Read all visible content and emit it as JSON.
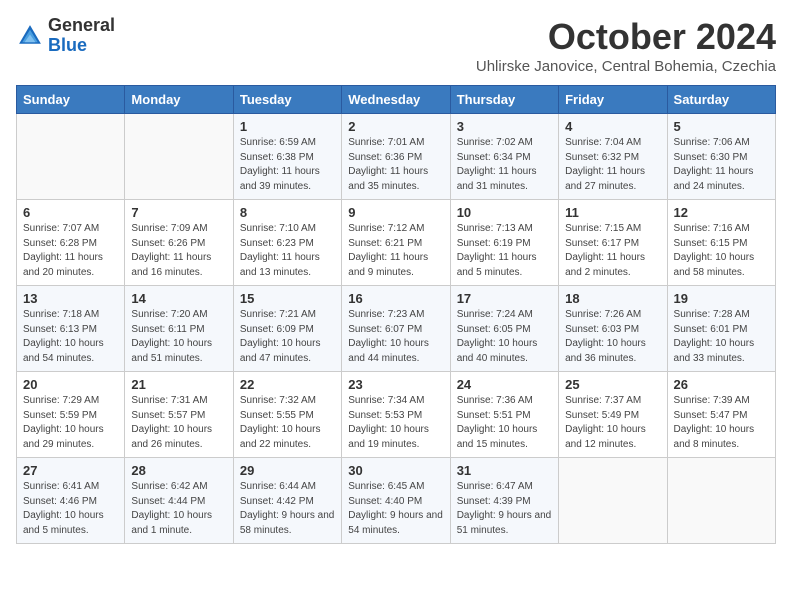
{
  "header": {
    "logo_general": "General",
    "logo_blue": "Blue",
    "month_title": "October 2024",
    "subtitle": "Uhlirske Janovice, Central Bohemia, Czechia"
  },
  "days_of_week": [
    "Sunday",
    "Monday",
    "Tuesday",
    "Wednesday",
    "Thursday",
    "Friday",
    "Saturday"
  ],
  "weeks": [
    [
      {
        "day": "",
        "info": ""
      },
      {
        "day": "",
        "info": ""
      },
      {
        "day": "1",
        "info": "Sunrise: 6:59 AM\nSunset: 6:38 PM\nDaylight: 11 hours and 39 minutes."
      },
      {
        "day": "2",
        "info": "Sunrise: 7:01 AM\nSunset: 6:36 PM\nDaylight: 11 hours and 35 minutes."
      },
      {
        "day": "3",
        "info": "Sunrise: 7:02 AM\nSunset: 6:34 PM\nDaylight: 11 hours and 31 minutes."
      },
      {
        "day": "4",
        "info": "Sunrise: 7:04 AM\nSunset: 6:32 PM\nDaylight: 11 hours and 27 minutes."
      },
      {
        "day": "5",
        "info": "Sunrise: 7:06 AM\nSunset: 6:30 PM\nDaylight: 11 hours and 24 minutes."
      }
    ],
    [
      {
        "day": "6",
        "info": "Sunrise: 7:07 AM\nSunset: 6:28 PM\nDaylight: 11 hours and 20 minutes."
      },
      {
        "day": "7",
        "info": "Sunrise: 7:09 AM\nSunset: 6:26 PM\nDaylight: 11 hours and 16 minutes."
      },
      {
        "day": "8",
        "info": "Sunrise: 7:10 AM\nSunset: 6:23 PM\nDaylight: 11 hours and 13 minutes."
      },
      {
        "day": "9",
        "info": "Sunrise: 7:12 AM\nSunset: 6:21 PM\nDaylight: 11 hours and 9 minutes."
      },
      {
        "day": "10",
        "info": "Sunrise: 7:13 AM\nSunset: 6:19 PM\nDaylight: 11 hours and 5 minutes."
      },
      {
        "day": "11",
        "info": "Sunrise: 7:15 AM\nSunset: 6:17 PM\nDaylight: 11 hours and 2 minutes."
      },
      {
        "day": "12",
        "info": "Sunrise: 7:16 AM\nSunset: 6:15 PM\nDaylight: 10 hours and 58 minutes."
      }
    ],
    [
      {
        "day": "13",
        "info": "Sunrise: 7:18 AM\nSunset: 6:13 PM\nDaylight: 10 hours and 54 minutes."
      },
      {
        "day": "14",
        "info": "Sunrise: 7:20 AM\nSunset: 6:11 PM\nDaylight: 10 hours and 51 minutes."
      },
      {
        "day": "15",
        "info": "Sunrise: 7:21 AM\nSunset: 6:09 PM\nDaylight: 10 hours and 47 minutes."
      },
      {
        "day": "16",
        "info": "Sunrise: 7:23 AM\nSunset: 6:07 PM\nDaylight: 10 hours and 44 minutes."
      },
      {
        "day": "17",
        "info": "Sunrise: 7:24 AM\nSunset: 6:05 PM\nDaylight: 10 hours and 40 minutes."
      },
      {
        "day": "18",
        "info": "Sunrise: 7:26 AM\nSunset: 6:03 PM\nDaylight: 10 hours and 36 minutes."
      },
      {
        "day": "19",
        "info": "Sunrise: 7:28 AM\nSunset: 6:01 PM\nDaylight: 10 hours and 33 minutes."
      }
    ],
    [
      {
        "day": "20",
        "info": "Sunrise: 7:29 AM\nSunset: 5:59 PM\nDaylight: 10 hours and 29 minutes."
      },
      {
        "day": "21",
        "info": "Sunrise: 7:31 AM\nSunset: 5:57 PM\nDaylight: 10 hours and 26 minutes."
      },
      {
        "day": "22",
        "info": "Sunrise: 7:32 AM\nSunset: 5:55 PM\nDaylight: 10 hours and 22 minutes."
      },
      {
        "day": "23",
        "info": "Sunrise: 7:34 AM\nSunset: 5:53 PM\nDaylight: 10 hours and 19 minutes."
      },
      {
        "day": "24",
        "info": "Sunrise: 7:36 AM\nSunset: 5:51 PM\nDaylight: 10 hours and 15 minutes."
      },
      {
        "day": "25",
        "info": "Sunrise: 7:37 AM\nSunset: 5:49 PM\nDaylight: 10 hours and 12 minutes."
      },
      {
        "day": "26",
        "info": "Sunrise: 7:39 AM\nSunset: 5:47 PM\nDaylight: 10 hours and 8 minutes."
      }
    ],
    [
      {
        "day": "27",
        "info": "Sunrise: 6:41 AM\nSunset: 4:46 PM\nDaylight: 10 hours and 5 minutes."
      },
      {
        "day": "28",
        "info": "Sunrise: 6:42 AM\nSunset: 4:44 PM\nDaylight: 10 hours and 1 minute."
      },
      {
        "day": "29",
        "info": "Sunrise: 6:44 AM\nSunset: 4:42 PM\nDaylight: 9 hours and 58 minutes."
      },
      {
        "day": "30",
        "info": "Sunrise: 6:45 AM\nSunset: 4:40 PM\nDaylight: 9 hours and 54 minutes."
      },
      {
        "day": "31",
        "info": "Sunrise: 6:47 AM\nSunset: 4:39 PM\nDaylight: 9 hours and 51 minutes."
      },
      {
        "day": "",
        "info": ""
      },
      {
        "day": "",
        "info": ""
      }
    ]
  ]
}
